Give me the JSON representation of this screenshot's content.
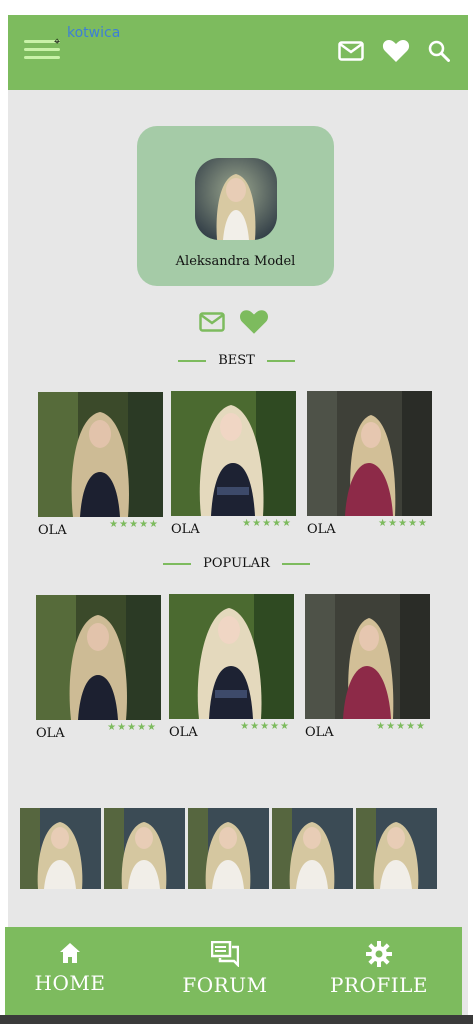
{
  "header": {
    "anchor_label": "kotwica",
    "anchor_marker": "⌖",
    "icons": [
      "menu-icon",
      "mail-icon",
      "heart-icon",
      "search-icon"
    ]
  },
  "profile": {
    "name": "Aleksandra Model"
  },
  "actions": [
    "mail-icon",
    "heart-icon"
  ],
  "sections": {
    "best": {
      "title": "BEST",
      "items": [
        {
          "name": "OLA",
          "rating": "★★★★★"
        },
        {
          "name": "OLA",
          "rating": "★★★★★"
        },
        {
          "name": "OLA",
          "rating": "★★★★★"
        }
      ]
    },
    "popular": {
      "title": "POPULAR",
      "items": [
        {
          "name": "OLA",
          "rating": "★★★★★"
        },
        {
          "name": "OLA",
          "rating": "★★★★★"
        },
        {
          "name": "OLA",
          "rating": "★★★★★"
        }
      ]
    }
  },
  "thumbnails_count": 5,
  "nav": {
    "home": "HOME",
    "forum": "FORUM",
    "profile": "PROFILE"
  },
  "colors": {
    "accent": "#7dbb5e",
    "card": "#a5cba7",
    "background": "#e7e7e7"
  }
}
